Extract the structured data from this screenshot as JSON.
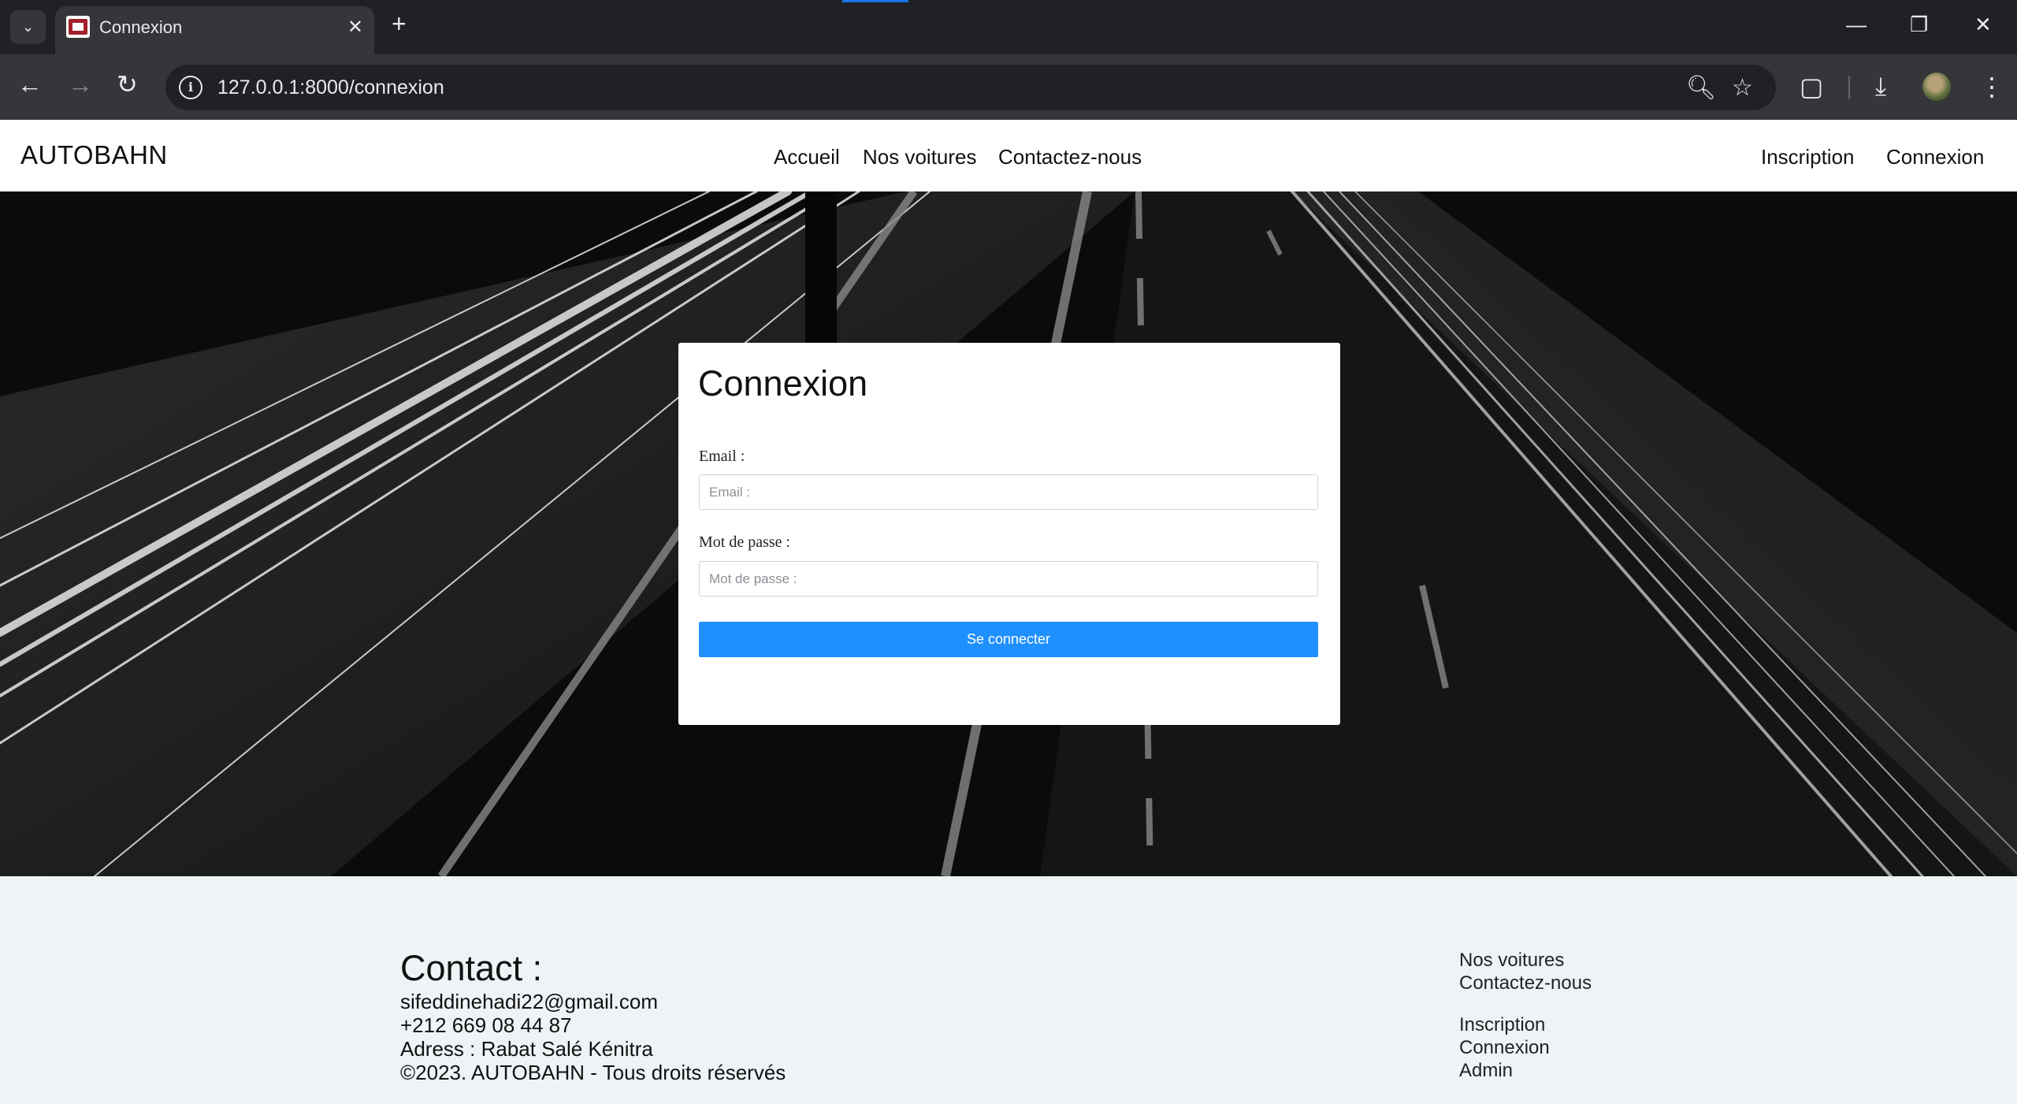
{
  "browser": {
    "tab_title": "Connexion",
    "url": "127.0.0.1:8000/connexion",
    "icons": [
      "tab-search-icon",
      "close-icon",
      "plus-icon",
      "minimize-icon",
      "restore-icon",
      "back-icon",
      "forward-icon",
      "reload-icon",
      "site-info-icon",
      "zoom-icon",
      "bookmark-star-icon",
      "extensions-icon",
      "download-icon",
      "profile-avatar",
      "more-menu-icon"
    ]
  },
  "site": {
    "logo": "AUTOBAHN",
    "nav": [
      "Accueil",
      "Nos voitures",
      "Contactez-nous"
    ],
    "auth": [
      "Inscription",
      "Connexion"
    ]
  },
  "login": {
    "title": "Connexion",
    "email_label": "Email :",
    "email_placeholder": "Email :",
    "password_label": "Mot de passe :",
    "password_placeholder": "Mot de passe :",
    "submit_label": "Se connecter"
  },
  "footer": {
    "contact_title": "Contact :",
    "email": "sifeddinehadi22@gmail.com",
    "phone": "+212 669 08 44 87",
    "address": "Adress : Rabat Salé Kénitra",
    "copyright": "©2023. AUTOBAHN - Tous droits réservés",
    "links": [
      "Nos voitures",
      "Contactez-nous",
      "Inscription",
      "Connexion",
      "Admin"
    ]
  },
  "colors": {
    "accent": "#1e90ff",
    "chrome_dark": "#202124",
    "chrome_toolbar": "#35363a",
    "footer_bg": "#eef3f6"
  }
}
